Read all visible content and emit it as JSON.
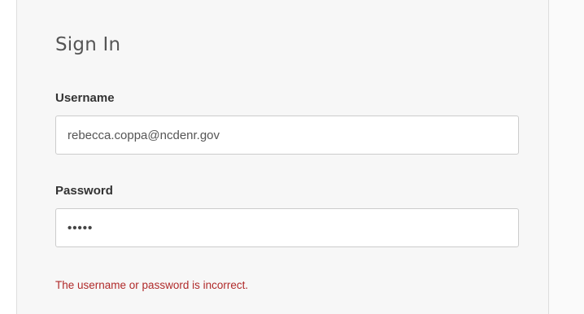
{
  "signin": {
    "title": "Sign In",
    "username_label": "Username",
    "username_value": "rebecca.coppa@ncdenr.gov",
    "password_label": "Password",
    "password_value": "•••••",
    "error_message": "The username or password is incorrect."
  }
}
